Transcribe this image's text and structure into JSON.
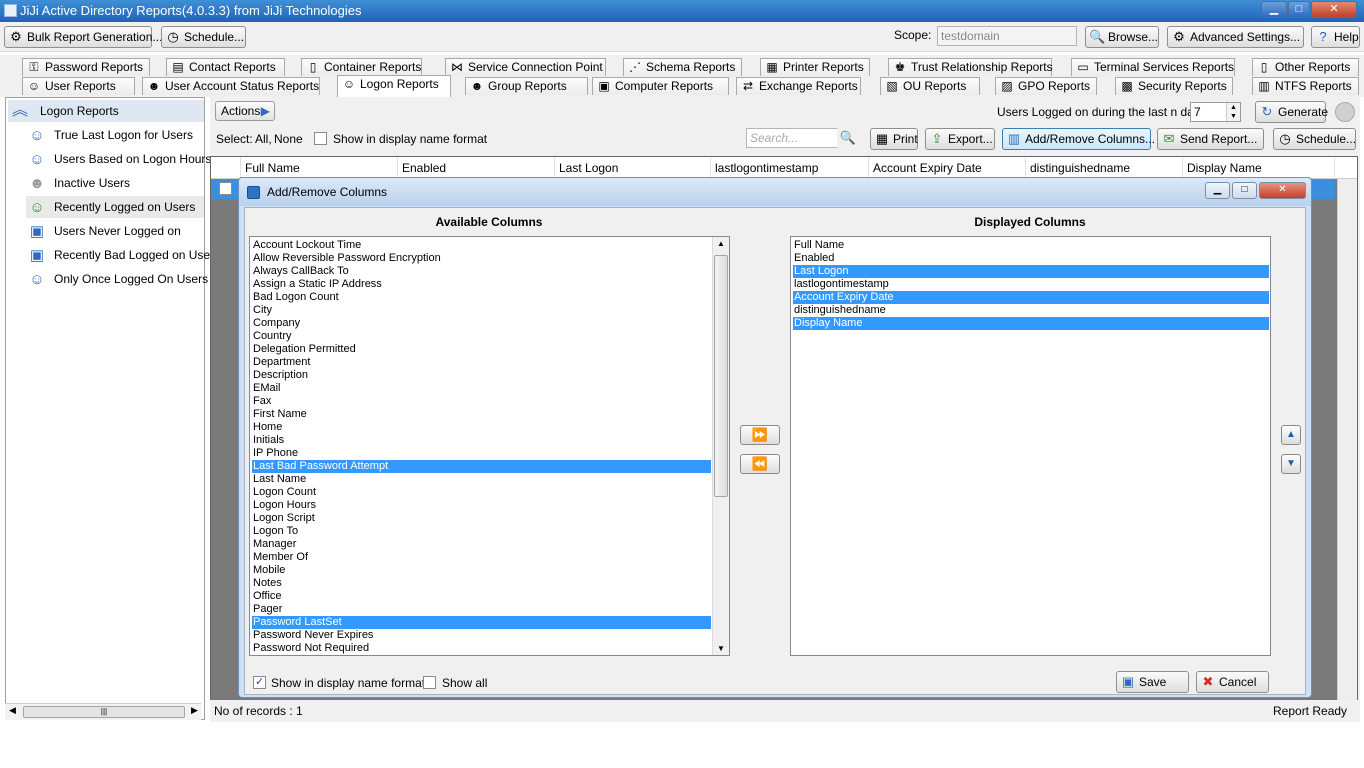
{
  "window": {
    "title": "JiJi Active Directory Reports(4.0.3.3) from JiJi Technologies",
    "controls": {
      "minimize": "▁",
      "maximize": "□",
      "close": "✕"
    }
  },
  "toolbar": {
    "bulk_label": "Bulk Report Generation...",
    "schedule_label": "Schedule...",
    "scope_label": "Scope:",
    "scope_value": "testdomain",
    "browse_label": "Browse...",
    "advanced_label": "Advanced  Settings...",
    "help_label": "Help"
  },
  "tabs": {
    "row1": [
      "Password Reports",
      "Contact Reports",
      "Container Reports",
      "Service Connection Point",
      "Schema Reports",
      "Printer Reports",
      "Trust Relationship Reports",
      "Terminal Services Reports",
      "Other Reports"
    ],
    "row2": [
      "User Reports",
      "User Account Status Reports",
      "Logon Reports",
      "Group Reports",
      "Computer Reports",
      "Exchange Reports",
      "OU Reports",
      "GPO Reports",
      "Security Reports",
      "NTFS Reports"
    ],
    "active": "Logon Reports"
  },
  "sidebar": {
    "header": "Logon Reports",
    "items": [
      {
        "label": "True Last Logon for Users",
        "icon": "user-clock-icon"
      },
      {
        "label": "Users Based on Logon Hours",
        "icon": "user-hours-icon"
      },
      {
        "label": "Inactive Users",
        "icon": "inactive-user-icon"
      },
      {
        "label": "Recently Logged on Users",
        "icon": "recent-logon-icon"
      },
      {
        "label": "Users Never Logged on",
        "icon": "never-logged-icon"
      },
      {
        "label": "Recently Bad Logged on Users",
        "icon": "bad-logon-icon"
      },
      {
        "label": "Only Once Logged On Users",
        "icon": "once-logged-icon"
      }
    ],
    "selected": "Recently Logged on Users",
    "scroll_grip": "|||"
  },
  "main": {
    "actions_label": "Actions",
    "days_label": "Users Logged on during the last n days:",
    "days_value": "7",
    "generate_label": "Generate",
    "select_label": "Select:",
    "select_all": "All,",
    "select_none": "None",
    "display_name_format": "Show in display name format",
    "search_placeholder": "Search...",
    "print_label": "Print",
    "export_label": "Export...",
    "addremove_label": "Add/Remove Columns...",
    "sendreport_label": "Send Report...",
    "schedule_label": "Schedule...",
    "columns": [
      "Full Name",
      "Enabled",
      "Last Logon",
      "lastlogontimestamp",
      "Account Expiry Date",
      "distinguishedname",
      "Display Name"
    ]
  },
  "status": {
    "records": "No of records : 1",
    "state": "Report Ready"
  },
  "dialog": {
    "title": "Add/Remove Columns",
    "available_header": "Available Columns",
    "displayed_header": "Displayed Columns",
    "available": [
      "Account Lockout Time",
      "Allow Reversible Password Encryption",
      "Always CallBack To",
      "Assign a Static IP Address",
      "Bad Logon Count",
      "City",
      "Company",
      "Country",
      "Delegation Permitted",
      "Department",
      "Description",
      "EMail",
      "Fax",
      "First Name",
      "Home",
      "Initials",
      "IP Phone",
      "Last Bad Password Attempt",
      "Last Name",
      "Logon Count",
      "Logon Hours",
      "Logon Script",
      "Logon To",
      "Manager",
      "Member Of",
      "Mobile",
      "Notes",
      "Office",
      "Pager",
      "Password LastSet",
      "Password Never Expires",
      "Password Not Required"
    ],
    "available_selected": [
      "Last Bad Password Attempt",
      "Password LastSet"
    ],
    "displayed": [
      "Full Name",
      "Enabled",
      "Last Logon",
      "lastlogontimestamp",
      "Account Expiry Date",
      "distinguishedname",
      "Display Name"
    ],
    "displayed_selected": [
      "Last Logon",
      "Account Expiry Date",
      "Display Name"
    ],
    "show_display_name": "Show in display name format",
    "show_all": "Show all",
    "save_label": "Save",
    "cancel_label": "Cancel"
  }
}
